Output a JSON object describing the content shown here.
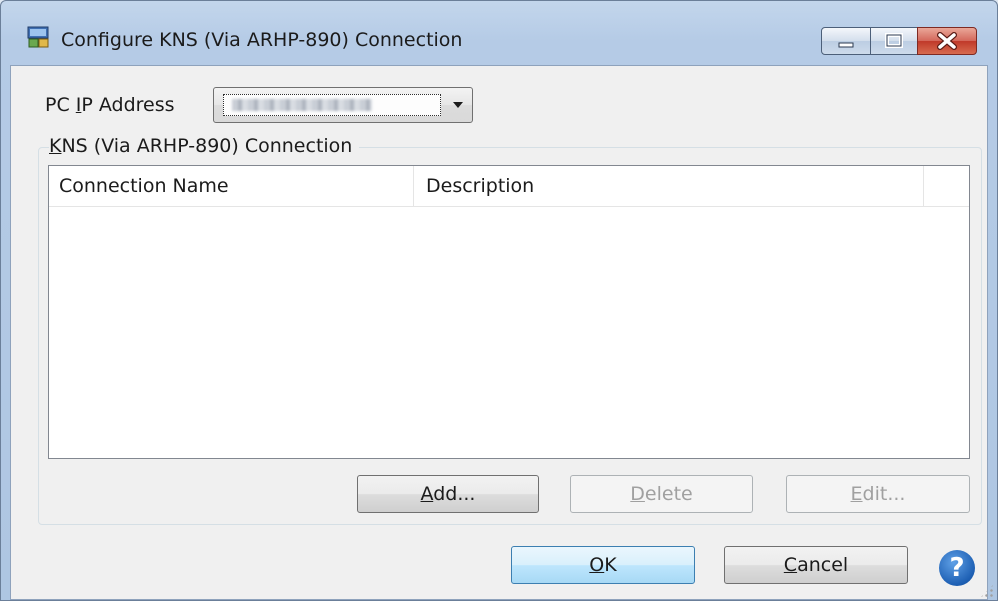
{
  "window": {
    "title": "Configure KNS (Via ARHP-890) Connection",
    "icon": "network-connection-icon",
    "controls": [
      "minimize-icon",
      "maximize-icon",
      "close-icon"
    ],
    "close_color": "#c0392a"
  },
  "pc_ip": {
    "label_prefix": "PC ",
    "label_mnemonic": "I",
    "label_suffix": "P Address",
    "value": ""
  },
  "group": {
    "title_mnemonic": "K",
    "title_rest": "NS (Via ARHP-890) Connection"
  },
  "connection_table": {
    "columns": [
      "Connection Name",
      "Description",
      ""
    ],
    "rows": []
  },
  "buttons": {
    "add": {
      "mnemonic": "A",
      "rest": "dd...",
      "enabled": true
    },
    "delete": {
      "mnemonic": "D",
      "rest": "elete",
      "enabled": false
    },
    "edit": {
      "mnemonic": "E",
      "rest": "dit...",
      "enabled": false
    },
    "ok": {
      "mnemonic": "O",
      "rest": "K",
      "default": true
    },
    "cancel": {
      "mnemonic": "C",
      "rest": "ancel"
    },
    "help": "?"
  }
}
